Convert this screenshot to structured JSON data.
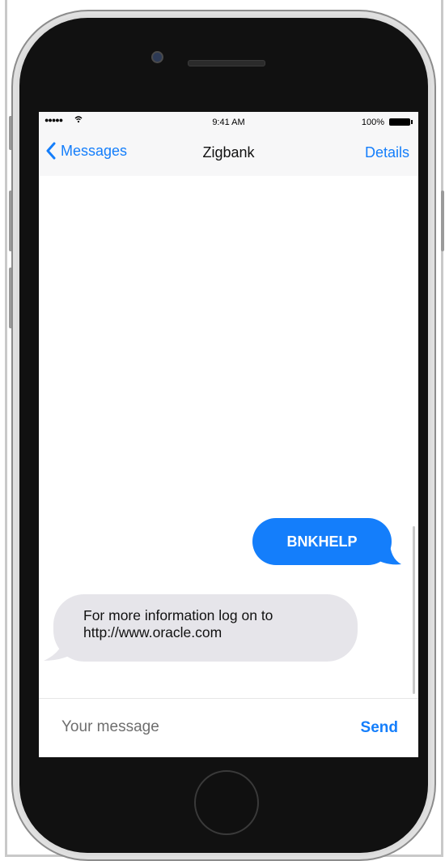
{
  "status_bar": {
    "signal": "●●●●●",
    "time": "9:41 AM",
    "battery": "100%"
  },
  "nav": {
    "back_label": "Messages",
    "title": "Zigbank",
    "details_label": "Details"
  },
  "messages": [
    {
      "direction": "sent",
      "text": "BNKHELP"
    },
    {
      "direction": "received",
      "lines": [
        "For more information log on to",
        "http://www.oracle.com"
      ]
    }
  ],
  "composer": {
    "placeholder": "Your message",
    "send_label": "Send"
  },
  "colors": {
    "accent": "#147efb",
    "received_bubble": "#e6e5ea",
    "phone_body": "#111111",
    "bar_background": "#f7f7f8"
  },
  "icons": [
    "wifi-icon",
    "battery-icon",
    "chevron-left-icon",
    "camera-icon",
    "home-button-icon"
  ]
}
